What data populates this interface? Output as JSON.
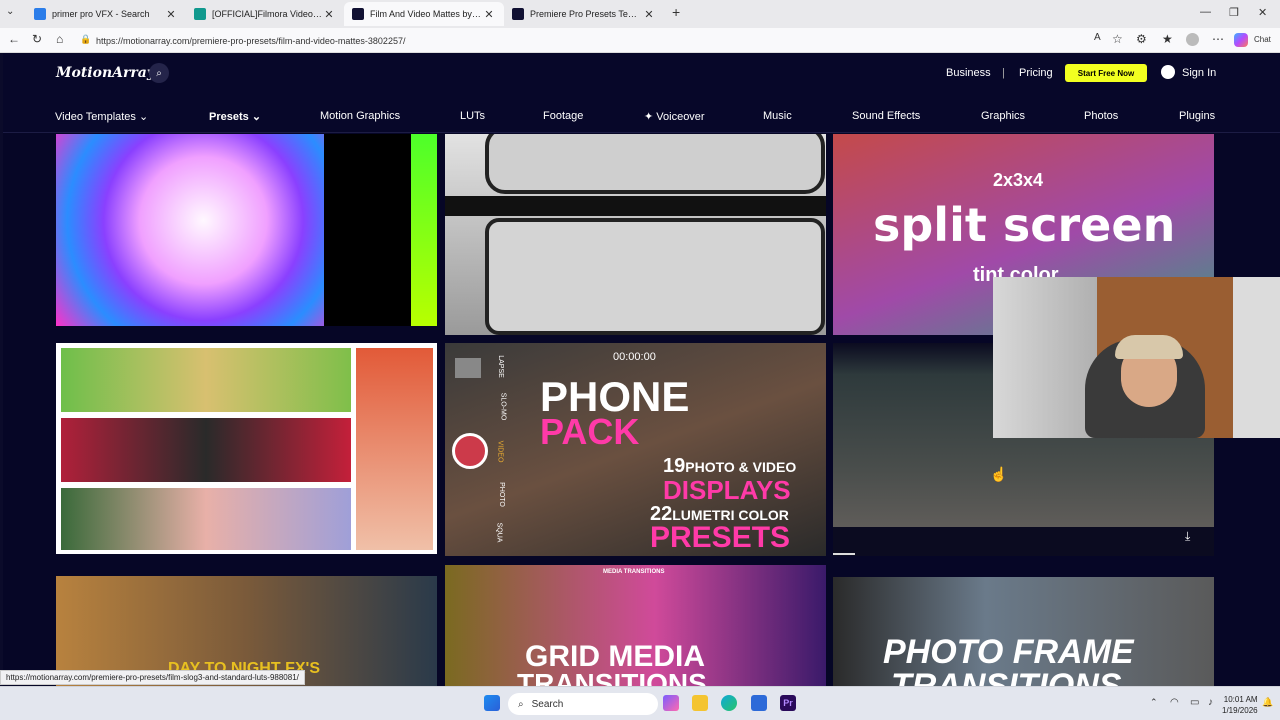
{
  "browser": {
    "tabs": [
      {
        "title": "primer pro VFX - Search",
        "color": "#2b7de9"
      },
      {
        "title": "[OFFICIAL]Filmora Video Editor - P",
        "color": "#11998e"
      },
      {
        "title": "Film And Video Mattes by Playgro",
        "color": "#111133"
      },
      {
        "title": "Premiere Pro Presets Templates -",
        "color": "#111133"
      }
    ],
    "new_tab": "+",
    "url": "https://motionarray.com/premiere-pro-presets/film-and-video-mattes-3802257/",
    "chat_label": "Chat",
    "status_url": "https://motionarray.com/premiere-pro-presets/film-slog3-and-standard-luts-988081/"
  },
  "site": {
    "logo": "MotionArray",
    "header_links": {
      "business": "Business",
      "divider": "|",
      "pricing": "Pricing",
      "start": "Start Free Now",
      "signin": "Sign In"
    },
    "categories": [
      "Video Templates",
      "Presets",
      "Motion Graphics",
      "LUTs",
      "Footage",
      "Voiceover",
      "Music",
      "Sound Effects",
      "Graphics",
      "Photos",
      "Plugins"
    ],
    "active_category": "Presets",
    "tiles": {
      "split_top": "2x3x4",
      "split_main": "split screen",
      "split_sub": "tint color",
      "phone_timer": "00:00:00",
      "phone_title1": "PHONE",
      "phone_title2": "PACK",
      "phone_line1_num": "19",
      "phone_line1_txt": "PHOTO & VIDEO",
      "phone_line2": "DISPLAYS",
      "phone_line3_num": "22",
      "phone_line3_txt": "LUMETRI COLOR",
      "phone_line4": "PRESETS",
      "phone_side": [
        "LAPSE",
        "SLO-MO",
        "VIDEO",
        "PHOTO",
        "SQUA"
      ],
      "daynight": "DAY TO NIGHT FX'S",
      "grid_tag": "MEDIA TRANSITIONS",
      "grid_main1": "GRID MEDIA",
      "grid_main2": "TRANSITIONS",
      "frame_main1": "PHOTO FRAME",
      "frame_main2": "TRANSITIONS"
    }
  },
  "taskbar": {
    "search": "Search",
    "time": "10:01 AM",
    "date": "1/19/2026"
  }
}
